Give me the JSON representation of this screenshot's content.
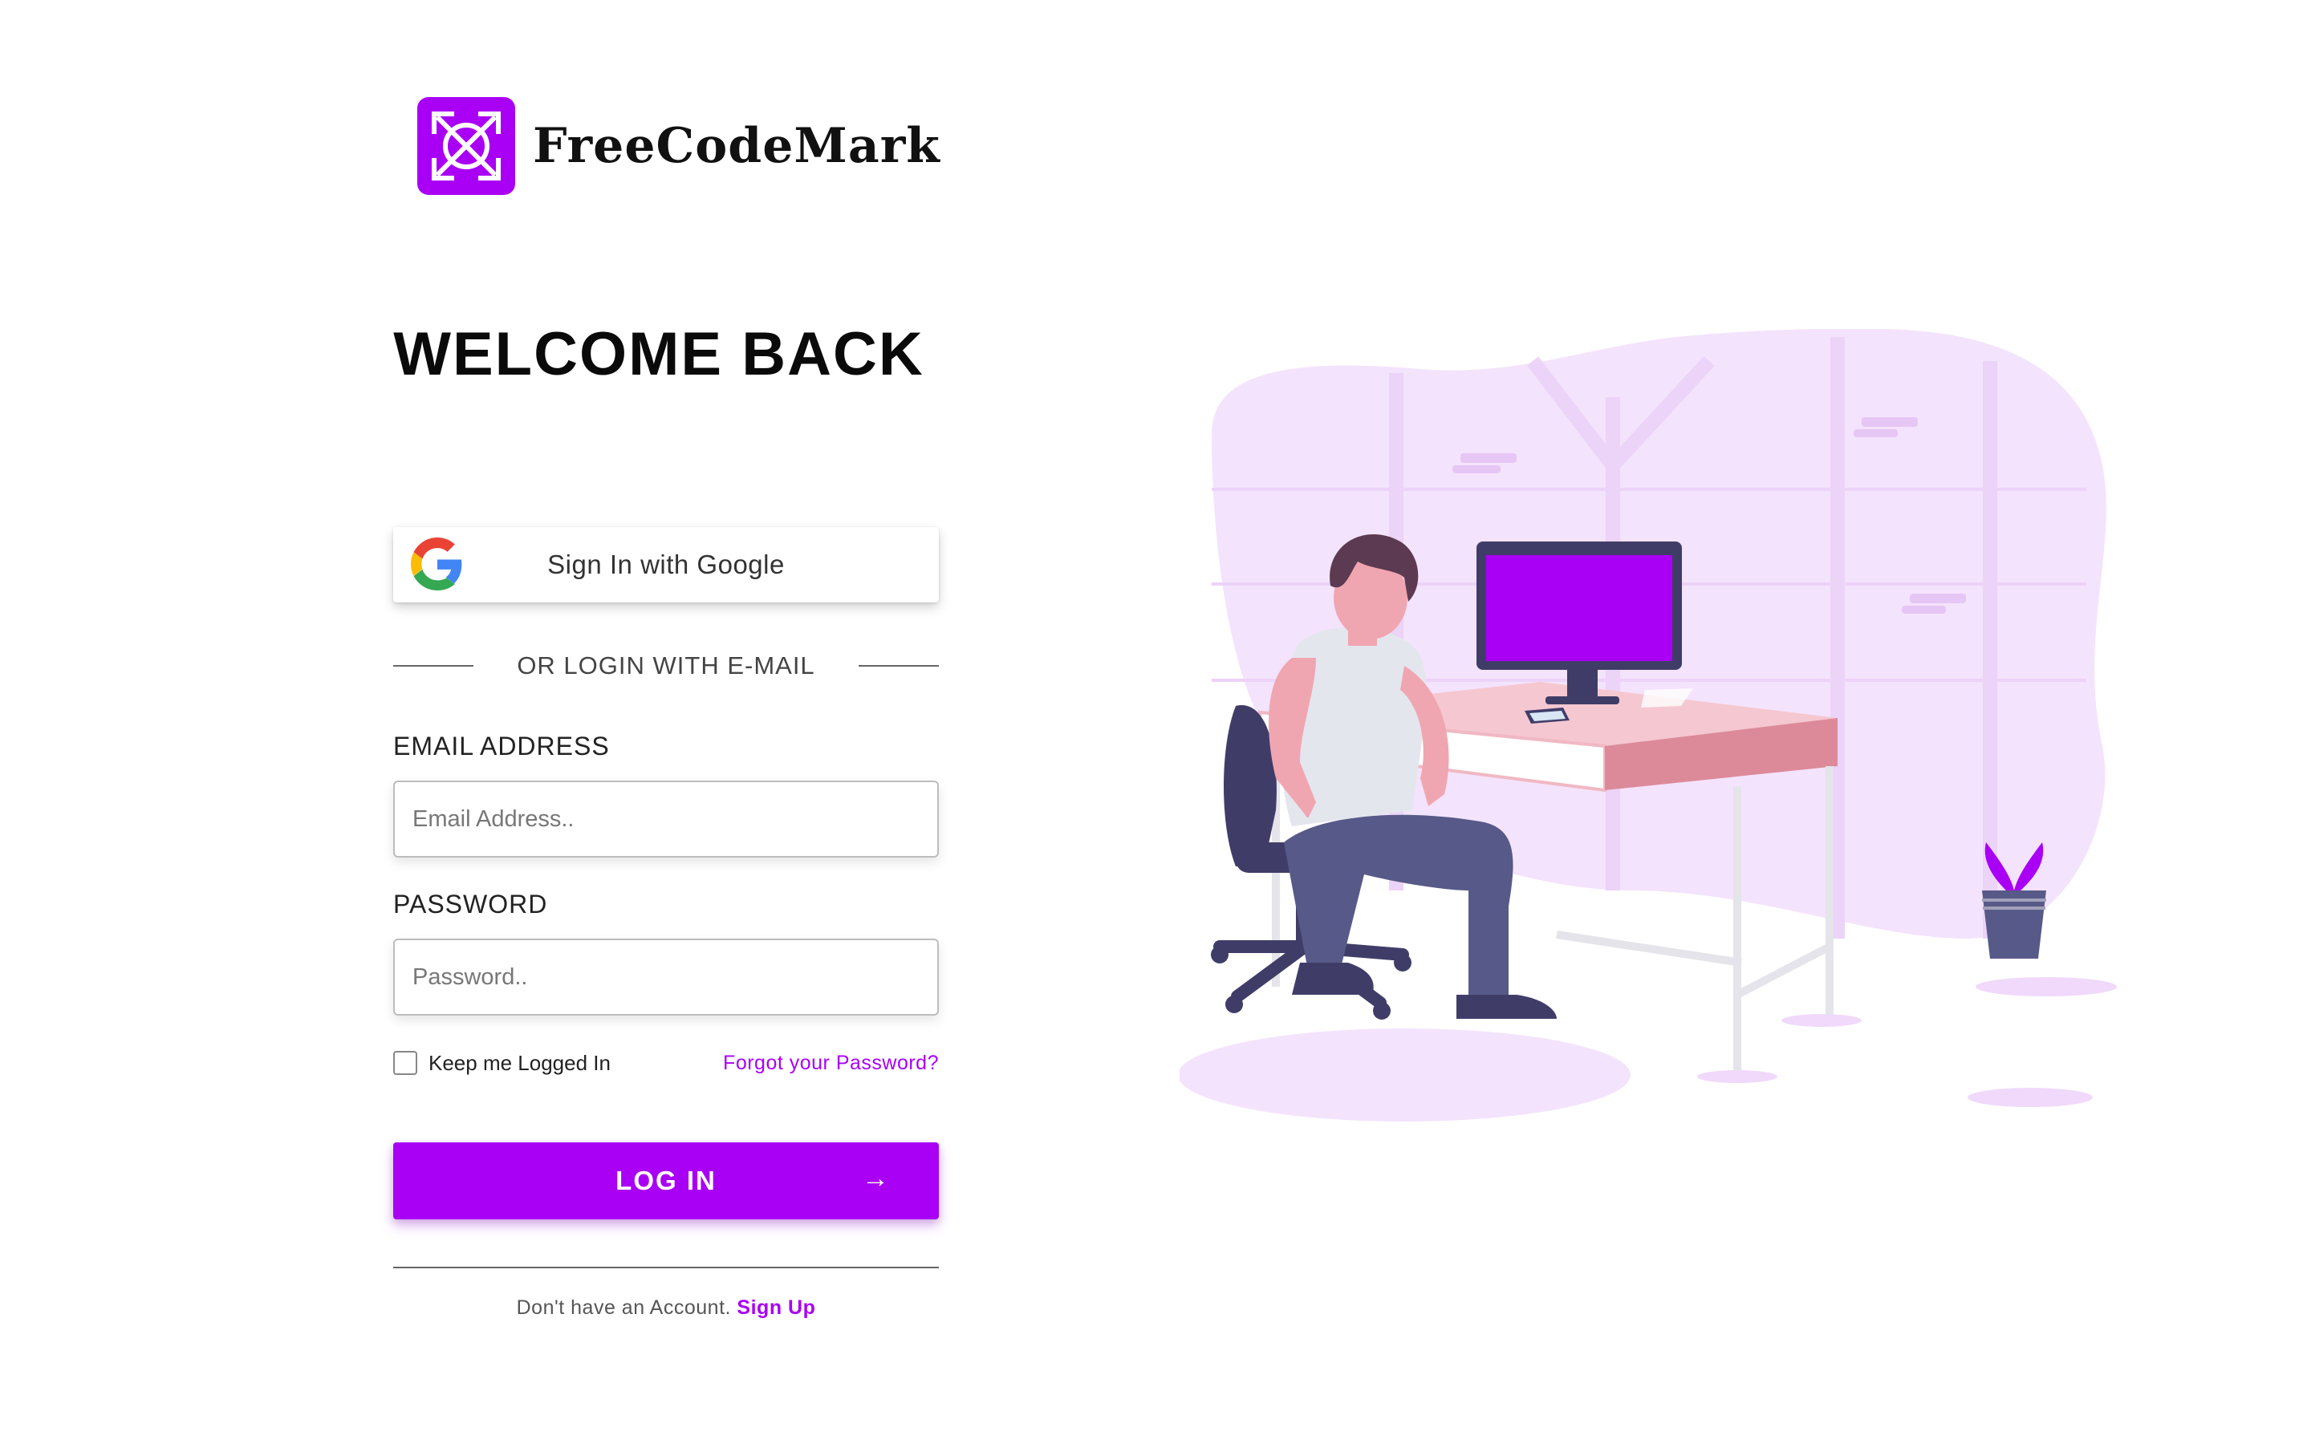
{
  "brand": {
    "name": "FreeCodeMark",
    "color": "#a900f5",
    "logo_icon": "compass-cross-icon"
  },
  "heading": "WELCOME BACK",
  "google_button": {
    "label": "Sign In with Google",
    "icon": "google-icon"
  },
  "divider_text": "OR LOGIN WITH E-MAIL",
  "email": {
    "label": "EMAIL ADDRESS",
    "placeholder": "Email Address..",
    "value": ""
  },
  "password": {
    "label": "PASSWORD",
    "placeholder": "Password..",
    "value": ""
  },
  "remember": {
    "label": "Keep me Logged In",
    "checked": false
  },
  "forgot_link": "Forgot your Password?",
  "login_button": {
    "label": "LOG IN",
    "icon": "arrow-right-icon"
  },
  "signup": {
    "prompt": "Don't have an Account.",
    "link": "Sign Up"
  }
}
